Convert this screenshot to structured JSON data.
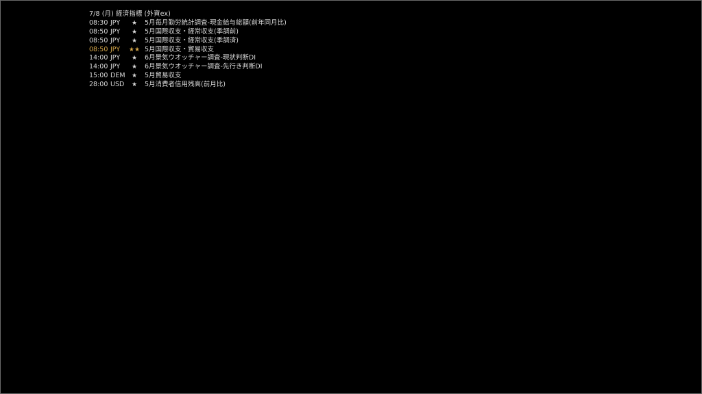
{
  "header": {
    "title": "7/8 (月) 経済指標 (外資ex)"
  },
  "colors": {
    "background": "#000000",
    "text": "#d9d9d9",
    "highlight": "#d7a84a",
    "border": "#6a6a6a"
  },
  "events": [
    {
      "time": "08:30",
      "currency": "JPY",
      "stars": "★",
      "name": "5月毎月勤労統計調査-現金給与総額(前年同月比)"
    },
    {
      "time": "08:50",
      "currency": "JPY",
      "stars": "★",
      "name": "5月国際収支・経常収支(季調前)"
    },
    {
      "time": "08:50",
      "currency": "JPY",
      "stars": "★",
      "name": "5月国際収支・経常収支(季調済)"
    },
    {
      "time": "08:50",
      "currency": "JPY",
      "stars": "★★",
      "name": "5月国際収支・貿易収支"
    },
    {
      "time": "14:00",
      "currency": "JPY",
      "stars": "★",
      "name": "6月景気ウオッチャー調査-現状判断DI"
    },
    {
      "time": "14:00",
      "currency": "JPY",
      "stars": "★",
      "name": "6月景気ウオッチャー調査-先行き判断DI"
    },
    {
      "time": "15:00",
      "currency": "DEM",
      "stars": "★",
      "name": "5月貿易収支"
    },
    {
      "time": "28:00",
      "currency": "USD",
      "stars": "★",
      "name": "5月消費者信用残高(前月比)"
    }
  ]
}
